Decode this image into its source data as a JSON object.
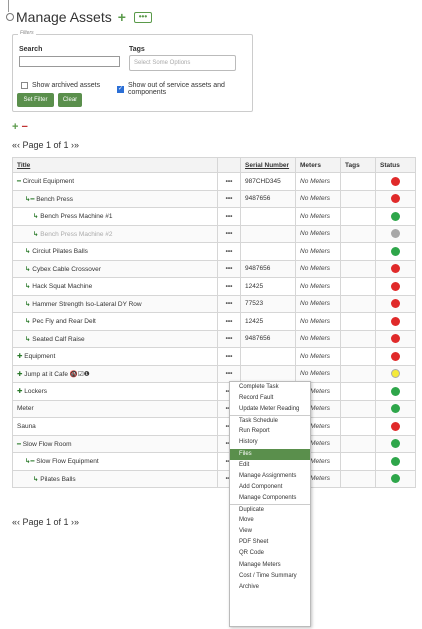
{
  "header": {
    "title": "Manage Assets",
    "add_icon": "plus-icon",
    "more_icon": "ellipsis-icon"
  },
  "filters": {
    "legend": "Filters",
    "search_label": "Search",
    "search_value": "",
    "tags_label": "Tags",
    "tags_placeholder": "Select Some Options",
    "show_archived_label": "Show archived assets",
    "show_archived_checked": false,
    "show_out_of_service_label": "Show out of service assets and components",
    "show_out_of_service_checked": true,
    "set_filter_label": "Set Filter",
    "clear_label": "Clear"
  },
  "pager": {
    "top": "«‹ Page 1 of 1 ›»",
    "bottom": "«‹ Page 1 of 1 ›»"
  },
  "table": {
    "headers": {
      "title": "Title",
      "dots": "",
      "serial": "Serial Number",
      "meters": "Meters",
      "tags": "Tags",
      "status": "Status"
    },
    "rows": [
      {
        "prefix": "━",
        "title": "Circuit Equipment",
        "serial": "987CHD345",
        "meters": "No Meters",
        "status": "red",
        "indent": 0,
        "muted": false
      },
      {
        "prefix": "↳━",
        "title": "Bench Press",
        "serial": "9487656",
        "meters": "No Meters",
        "status": "red",
        "indent": 1,
        "muted": false
      },
      {
        "prefix": "↳",
        "title": "Bench Press Machine #1",
        "serial": "",
        "meters": "No Meters",
        "status": "green",
        "indent": 2,
        "muted": false
      },
      {
        "prefix": "↳",
        "title": "Bench Press Machine #2",
        "serial": "",
        "meters": "No Meters",
        "status": "grey",
        "indent": 2,
        "muted": true
      },
      {
        "prefix": "↳",
        "title": "Circiut Pilates Balls",
        "serial": "",
        "meters": "No Meters",
        "status": "green",
        "indent": 1,
        "muted": false
      },
      {
        "prefix": "↳",
        "title": "Cybex Cable Crossover",
        "serial": "9487656",
        "meters": "No Meters",
        "status": "red",
        "indent": 1,
        "muted": false
      },
      {
        "prefix": "↳",
        "title": "Hack Squat Machine",
        "serial": "12425",
        "meters": "No Meters",
        "status": "red",
        "indent": 1,
        "muted": false
      },
      {
        "prefix": "↳",
        "title": "Hammer Strength Iso-Lateral DY Row",
        "serial": "77523",
        "meters": "No Meters",
        "status": "red",
        "indent": 1,
        "muted": false
      },
      {
        "prefix": "↳",
        "title": "Pec Fly and Rear Delt",
        "serial": "12425",
        "meters": "No Meters",
        "status": "red",
        "indent": 1,
        "muted": false
      },
      {
        "prefix": "↳",
        "title": "Seated Calf Raise",
        "serial": "9487656",
        "meters": "No Meters",
        "status": "red",
        "indent": 1,
        "muted": false
      },
      {
        "prefix": "✚",
        "title": "Equipment",
        "serial": "",
        "meters": "No Meters",
        "status": "red",
        "indent": 0,
        "muted": false
      },
      {
        "prefix": "✚",
        "title": "Jump at it Cafe 🚳☑❶",
        "serial": "",
        "meters": "No Meters",
        "status": "yellow",
        "indent": 0,
        "muted": false
      },
      {
        "prefix": "✚",
        "title": "Lockers",
        "serial": "",
        "meters": "No Meters",
        "status": "green",
        "indent": 0,
        "muted": false
      },
      {
        "prefix": "",
        "title": "Meter",
        "serial": "",
        "meters": "No Meters",
        "status": "green",
        "indent": 0,
        "muted": false
      },
      {
        "prefix": "",
        "title": "Sauna",
        "serial": "",
        "meters": "No Meters",
        "status": "red",
        "indent": 0,
        "muted": false
      },
      {
        "prefix": "━",
        "title": "Slow Flow Room",
        "serial": "",
        "meters": "No Meters",
        "status": "green",
        "indent": 0,
        "muted": false
      },
      {
        "prefix": "↳━",
        "title": "Slow Flow Equipment",
        "serial": "",
        "meters": "No Meters",
        "status": "green",
        "indent": 1,
        "muted": false
      },
      {
        "prefix": "↳",
        "title": "Pilates Balls",
        "serial": "",
        "meters": "No Meters",
        "status": "green",
        "indent": 2,
        "muted": false
      }
    ]
  },
  "context_menu": {
    "items": [
      {
        "label": "Complete Task",
        "sep": false,
        "active": false
      },
      {
        "label": "Record Fault",
        "sep": false,
        "active": false
      },
      {
        "label": "Update Meter Reading",
        "sep": false,
        "active": false
      },
      {
        "label": "Task Schedule",
        "sep": true,
        "active": false
      },
      {
        "label": "Run Report",
        "sep": false,
        "active": false
      },
      {
        "label": "History",
        "sep": false,
        "active": false
      },
      {
        "label": "Files",
        "sep": false,
        "active": true
      },
      {
        "label": "Edit",
        "sep": false,
        "active": false
      },
      {
        "label": "Manage Assignments",
        "sep": false,
        "active": false
      },
      {
        "label": "Add Component",
        "sep": false,
        "active": false
      },
      {
        "label": "Manage Components",
        "sep": false,
        "active": false
      },
      {
        "label": "Duplicate",
        "sep": true,
        "active": false
      },
      {
        "label": "Move",
        "sep": false,
        "active": false
      },
      {
        "label": "View",
        "sep": false,
        "active": false
      },
      {
        "label": "PDF Sheet",
        "sep": false,
        "active": false
      },
      {
        "label": "QR Code",
        "sep": false,
        "active": false
      },
      {
        "label": "Manage Meters",
        "sep": false,
        "active": false
      },
      {
        "label": "Cost / Time Summary",
        "sep": false,
        "active": false
      },
      {
        "label": "Archive",
        "sep": false,
        "active": false
      }
    ]
  },
  "colors": {
    "accent_green": "#5a8f4c",
    "status_red": "#e02a2a",
    "status_green": "#2ea64a",
    "status_grey": "#a8a8a8",
    "status_yellow": "#f4ea3a"
  }
}
